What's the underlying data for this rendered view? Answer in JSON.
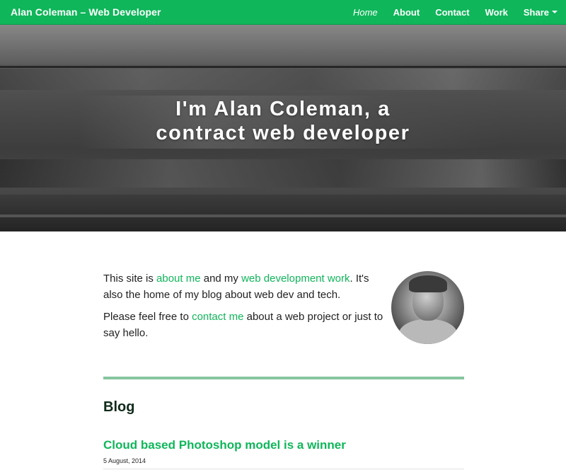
{
  "nav": {
    "brand": "Alan Coleman – Web Developer",
    "items": [
      {
        "label": "Home"
      },
      {
        "label": "About"
      },
      {
        "label": "Contact"
      },
      {
        "label": "Work"
      },
      {
        "label": "Share"
      }
    ]
  },
  "hero": {
    "title": "I'm Alan Coleman, a contract web developer"
  },
  "intro": {
    "p1_before": "This site is ",
    "p1_link1": "about me",
    "p1_mid": " and my ",
    "p1_link2": "web development work",
    "p1_after": ". It's also the home of my blog about web dev and tech.",
    "p2_before": "Please feel free to ",
    "p2_link": "contact me",
    "p2_after": " about a web project or just to say hello."
  },
  "blog": {
    "heading": "Blog",
    "posts": [
      {
        "title": "Cloud based Photoshop model is a winner",
        "date": "5 August, 2014"
      }
    ]
  },
  "colors": {
    "accent": "#0fb65a",
    "divider": "#86c59f"
  },
  "icons": {
    "share_caret": "caret-down-icon"
  }
}
